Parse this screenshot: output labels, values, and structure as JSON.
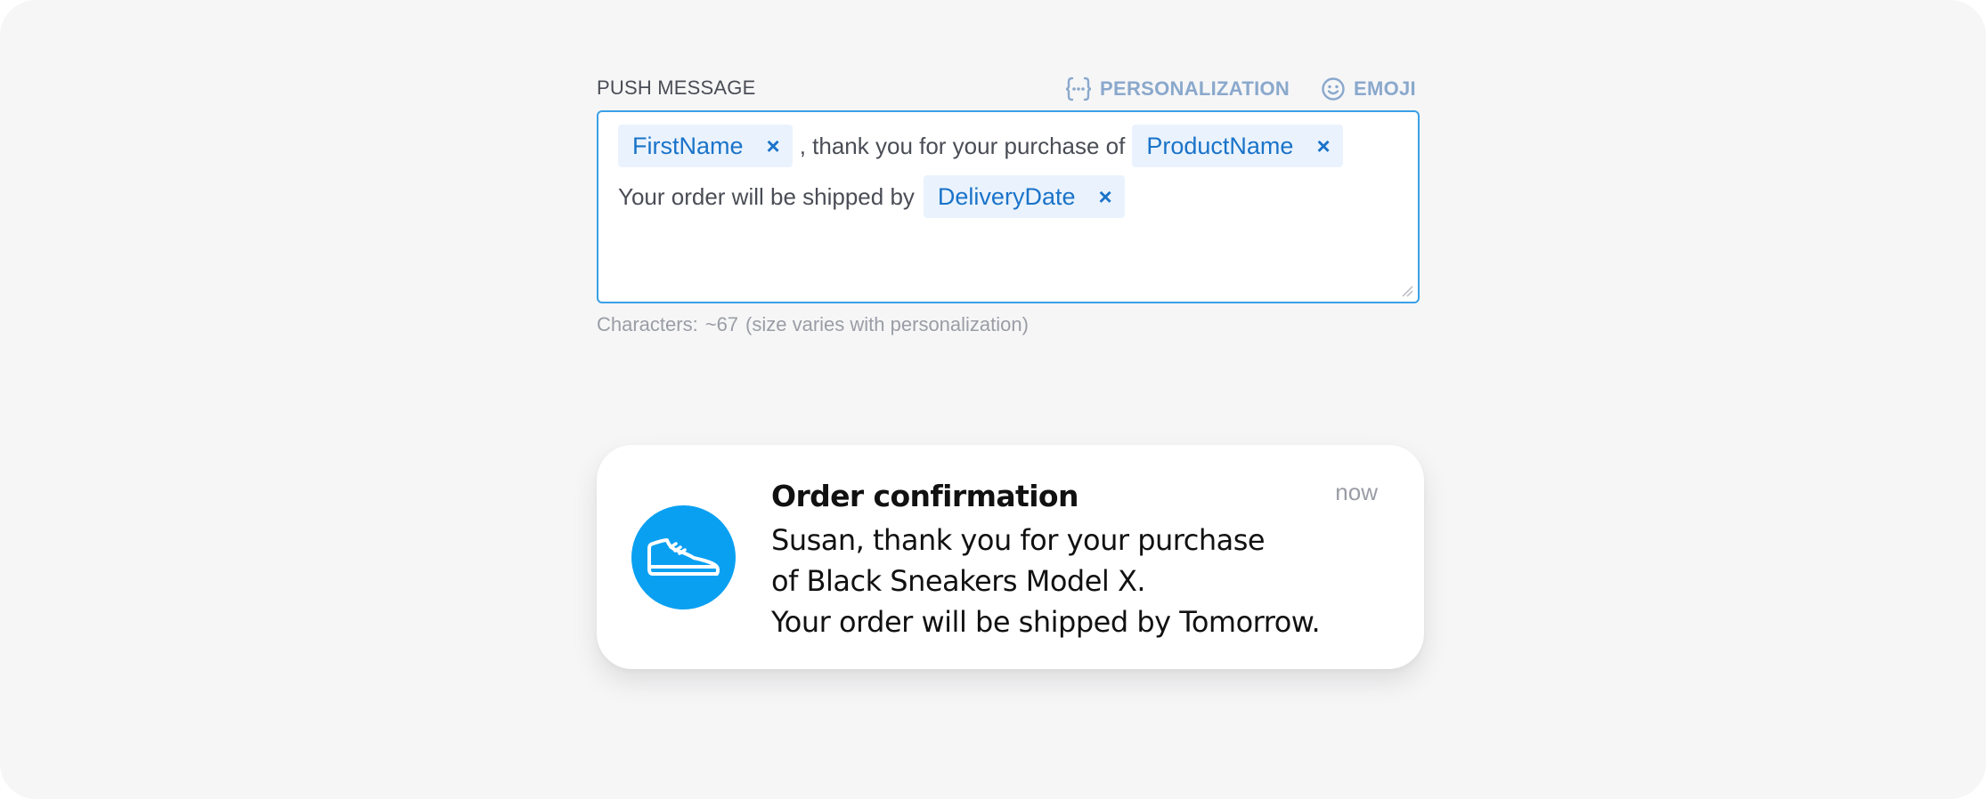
{
  "editor": {
    "label": "PUSH MESSAGE",
    "personalization_label": "PERSONALIZATION",
    "emoji_label": "EMOJI",
    "line1": {
      "chip1": "FirstName",
      "text1": ", thank you for your purchase of",
      "chip2": "ProductName"
    },
    "line2": {
      "text1": "Your order will be shipped by",
      "chip1": "DeliveryDate"
    },
    "chip_remove_glyph": "×",
    "char_count_label": "Characters:",
    "char_count_value": "~67",
    "char_count_note": "(size varies with personalization)"
  },
  "notification": {
    "icon": "sneaker-icon",
    "title": "Order confirmation",
    "time": "now",
    "body_lines": [
      "Susan, thank you for your purchase",
      "of Black Sneakers Model X.",
      "Your order will be shipped by Tomorrow."
    ]
  },
  "colors": {
    "background": "#f6f6f7",
    "editor_border": "#3aa0e6",
    "chip_bg": "#eaf3fd",
    "chip_text": "#1a73c9",
    "header_action": "#8aa8cc",
    "app_icon_bg": "#0aa0f2"
  }
}
